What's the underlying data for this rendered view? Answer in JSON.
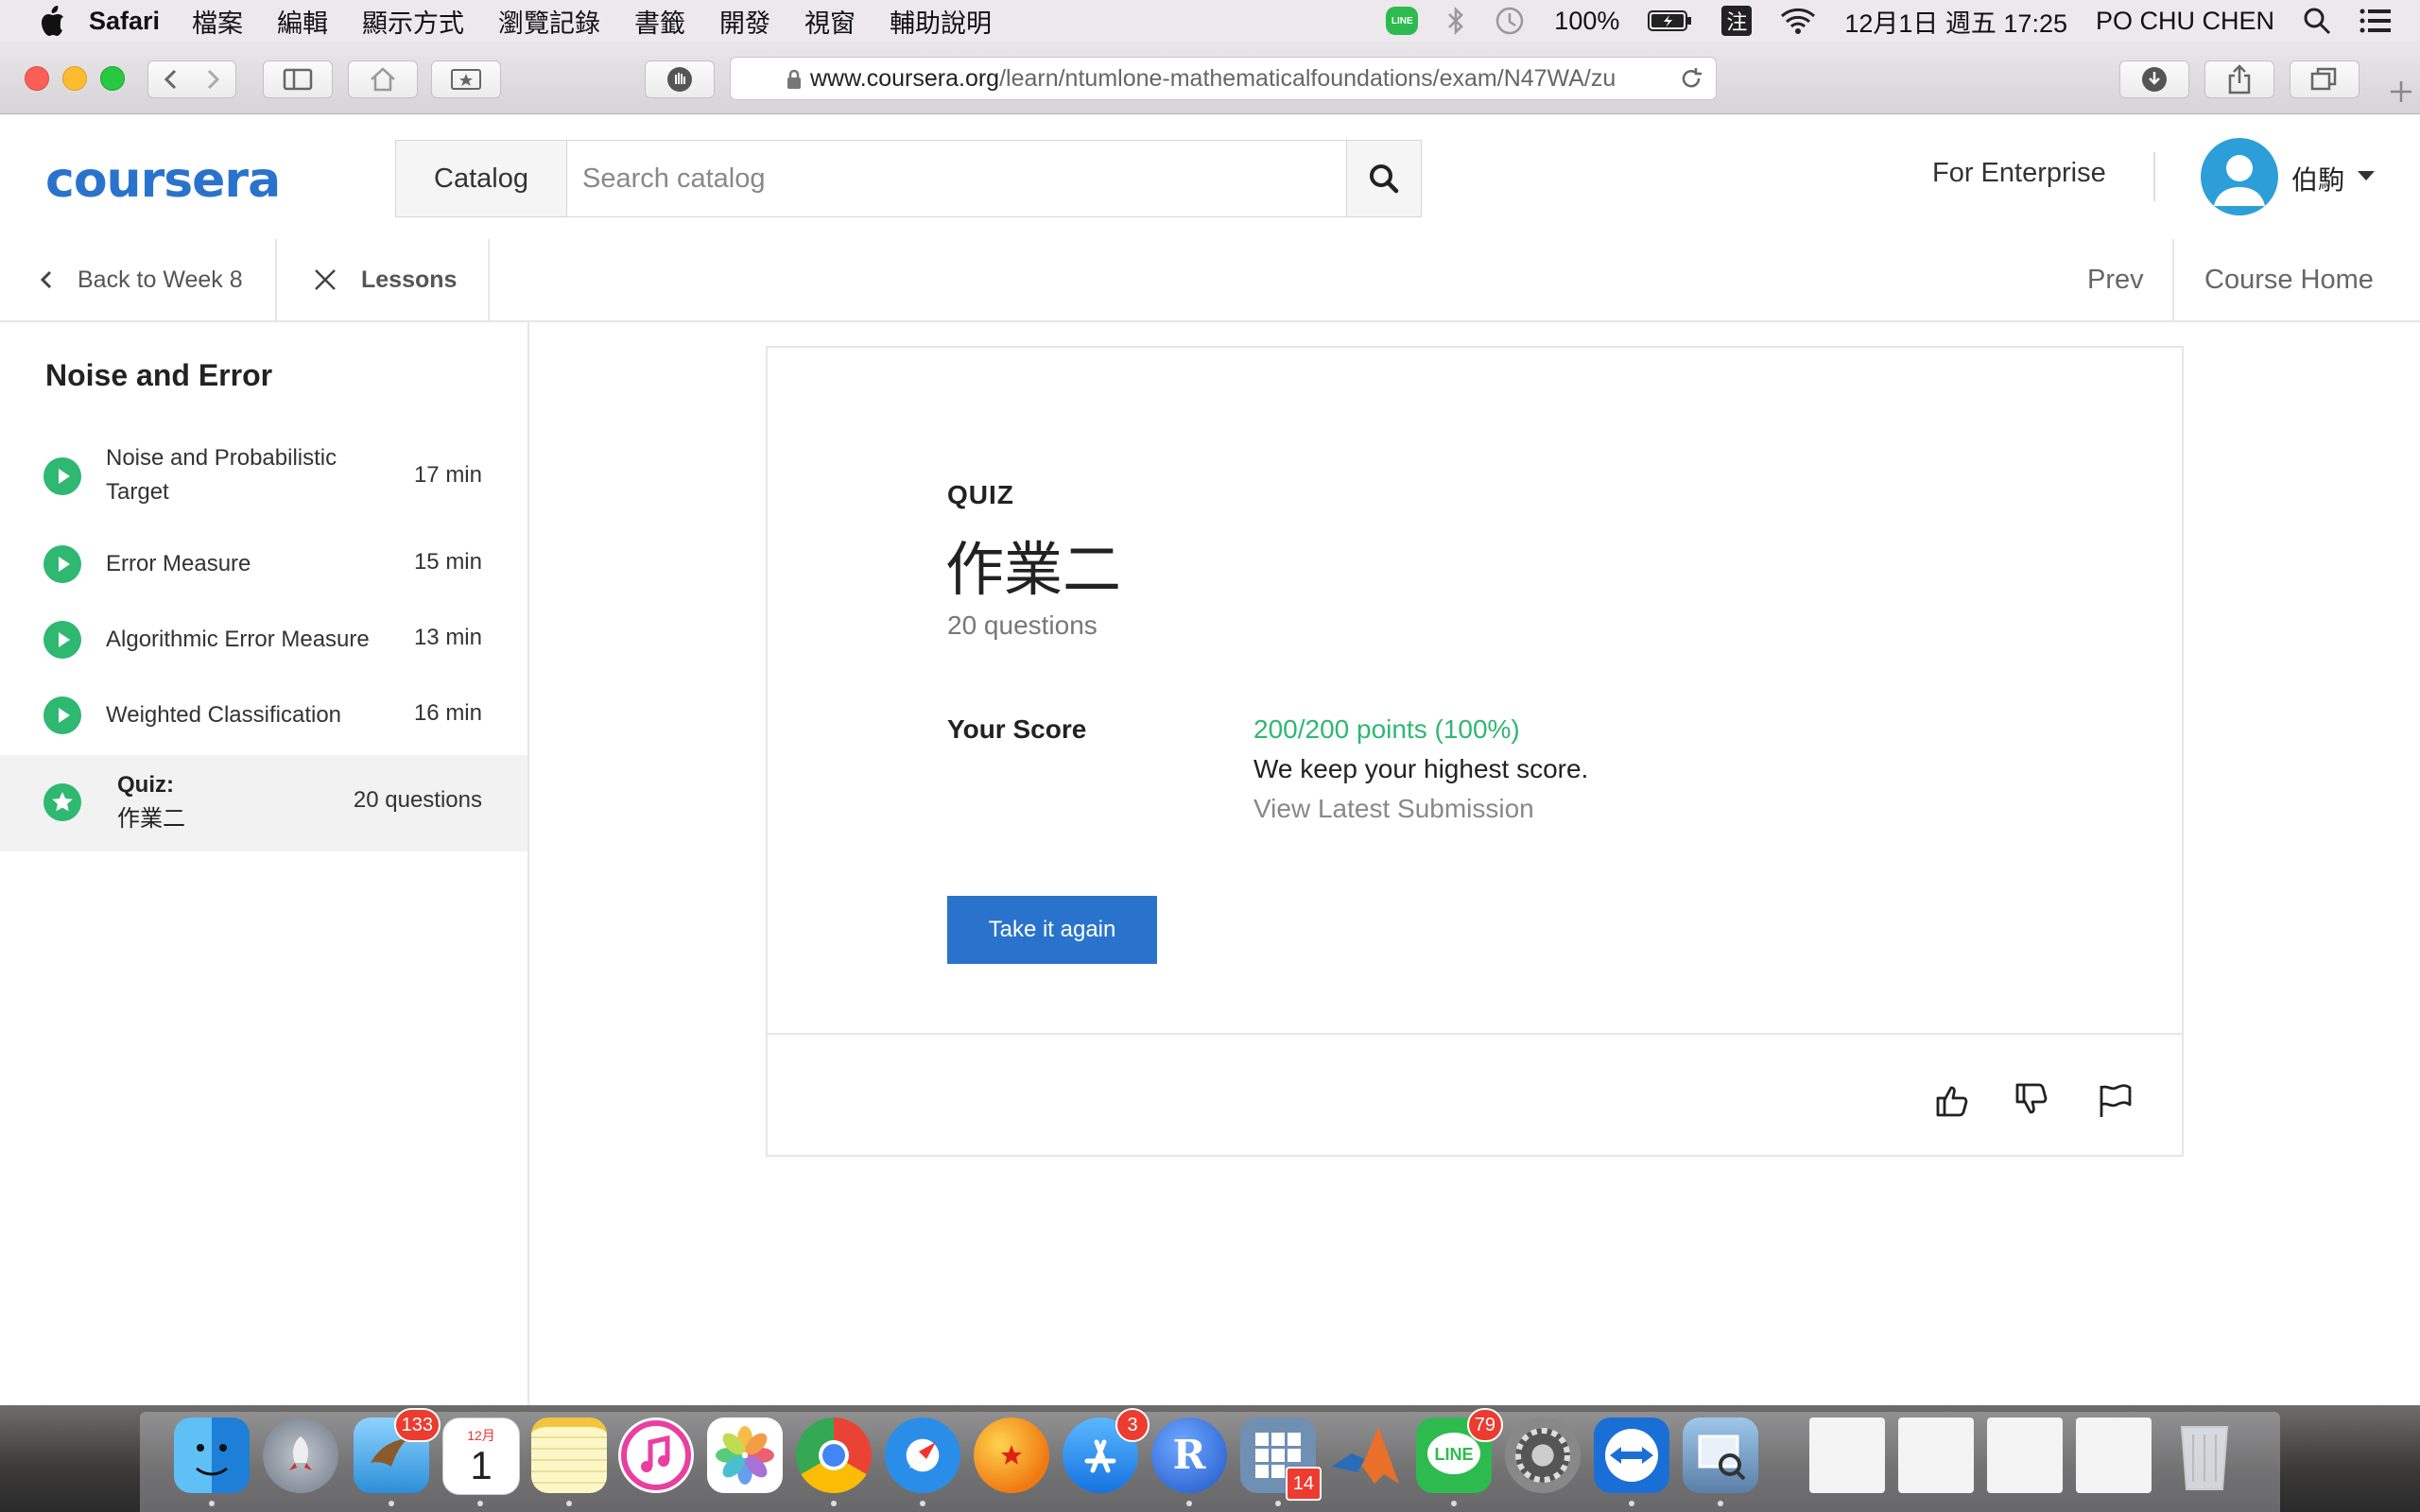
{
  "menubar": {
    "app_name": "Safari",
    "menus": [
      "檔案",
      "編輯",
      "顯示方式",
      "瀏覽記錄",
      "書籤",
      "開發",
      "視窗",
      "輔助說明"
    ],
    "line_label": "LINE",
    "battery": "100%",
    "ime": "注",
    "datetime": "12月1日 週五 17:25",
    "user": "PO CHU CHEN"
  },
  "browser": {
    "url_domain": "www.coursera.org",
    "url_path": "/learn/ntumlone-mathematicalfoundations/exam/N47WA/zu"
  },
  "header": {
    "logo": "coursera",
    "catalog_label": "Catalog",
    "search_placeholder": "Search catalog",
    "enterprise_label": "For Enterprise",
    "username": "伯駒"
  },
  "subnav": {
    "back_label": "Back to Week 8",
    "lessons_label": "Lessons",
    "prev_label": "Prev",
    "course_home_label": "Course Home"
  },
  "sidebar": {
    "title": "Noise and Error",
    "lessons": [
      {
        "title": "Noise and Probabilistic Target",
        "duration": "17 min"
      },
      {
        "title": "Error Measure",
        "duration": "15 min"
      },
      {
        "title": "Algorithmic Error Measure",
        "duration": "13 min"
      },
      {
        "title": "Weighted Classification",
        "duration": "16 min"
      }
    ],
    "quiz": {
      "label": "Quiz:",
      "name": "作業二",
      "count": "20 questions"
    }
  },
  "quiz": {
    "label": "QUIZ",
    "title": "作業二",
    "question_count": "20 questions",
    "score_label": "Your Score",
    "score_value": "200/200 points (100%)",
    "score_note": "We keep your highest score.",
    "view_link": "View Latest Submission",
    "retake_label": "Take it again"
  },
  "dock": {
    "badges": {
      "mail": "133",
      "calendar_month": "12月",
      "calendar_day": "1",
      "appstore": "3",
      "launchpad": "14",
      "line": "79"
    }
  },
  "colors": {
    "brand": "#2a73cc",
    "success": "#2eb872",
    "avatar": "#2c9fd9"
  }
}
